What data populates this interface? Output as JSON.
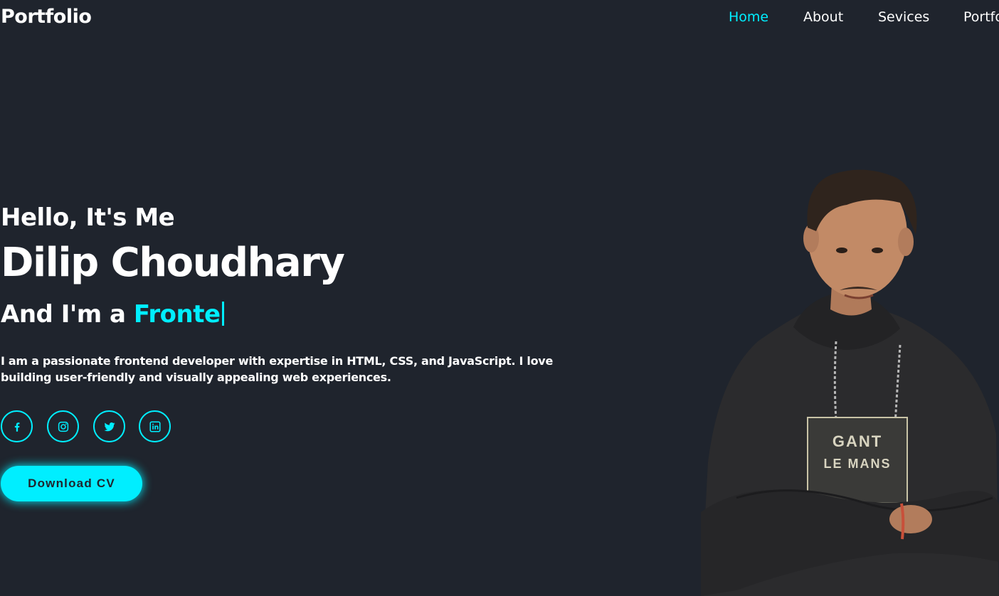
{
  "header": {
    "logo": "Portfolio",
    "nav": [
      {
        "label": "Home",
        "active": true
      },
      {
        "label": "About",
        "active": false
      },
      {
        "label": "Sevices",
        "active": false
      },
      {
        "label": "Portfo",
        "active": false
      }
    ]
  },
  "hero": {
    "greeting": "Hello, It's Me",
    "name": "Dilip Choudhary",
    "role_prefix": "And I'm a ",
    "role_typed": "Fronte",
    "description": "I am a passionate frontend developer with expertise in HTML, CSS, and JavaScript. I love building user-friendly and visually appealing web experiences.",
    "social": [
      {
        "icon": "facebook-icon"
      },
      {
        "icon": "instagram-icon"
      },
      {
        "icon": "twitter-icon"
      },
      {
        "icon": "linkedin-icon"
      }
    ],
    "cta_label": "Download CV",
    "photo": {
      "shirt_text_line1": "GANT",
      "shirt_text_line2": "LE MANS"
    }
  },
  "colors": {
    "background": "#1f242d",
    "accent": "#00eeff",
    "text": "#ffffff"
  }
}
